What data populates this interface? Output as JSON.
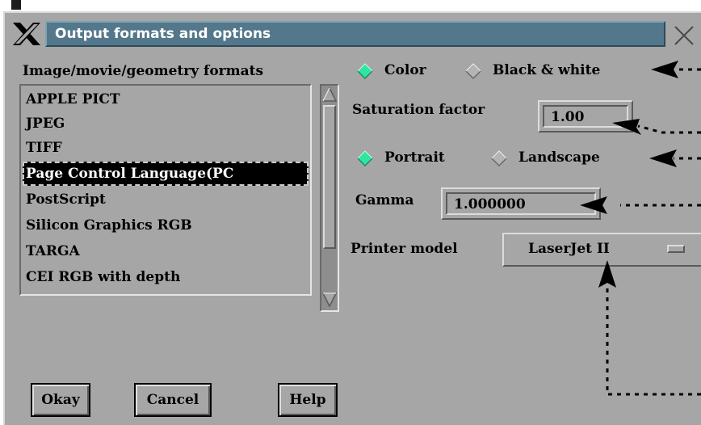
{
  "window": {
    "title": "Output formats and options",
    "x_logo": "x-window-logo",
    "close_icon": "close-icon"
  },
  "formats": {
    "label": "Image/movie/geometry formats",
    "items": [
      "APPLE PICT",
      "JPEG",
      "TIFF",
      "Page Control Language(PC",
      "PostScript",
      "Silicon Graphics RGB",
      "TARGA",
      "CEI RGB with depth"
    ],
    "selected": "Page Control Language(PC"
  },
  "color_mode": {
    "options": [
      "Color",
      "Black & white"
    ],
    "selected": "Color"
  },
  "saturation": {
    "label": "Saturation factor",
    "value": "1.00"
  },
  "orientation": {
    "options": [
      "Portrait",
      "Landscape"
    ],
    "selected": "Portrait"
  },
  "gamma": {
    "label": "Gamma",
    "value": "1.000000"
  },
  "printer_model": {
    "label": "Printer model",
    "value": "LaserJet II"
  },
  "buttons": {
    "okay": "Okay",
    "cancel": "Cancel",
    "help": "Help"
  },
  "colors": {
    "window_bg": "#a6a6a6",
    "title_bar": "#54788b",
    "radio_selected": "#2ee6a0",
    "radio_unselected": "#b4b4b4",
    "annotation_arrow": "#000000"
  }
}
